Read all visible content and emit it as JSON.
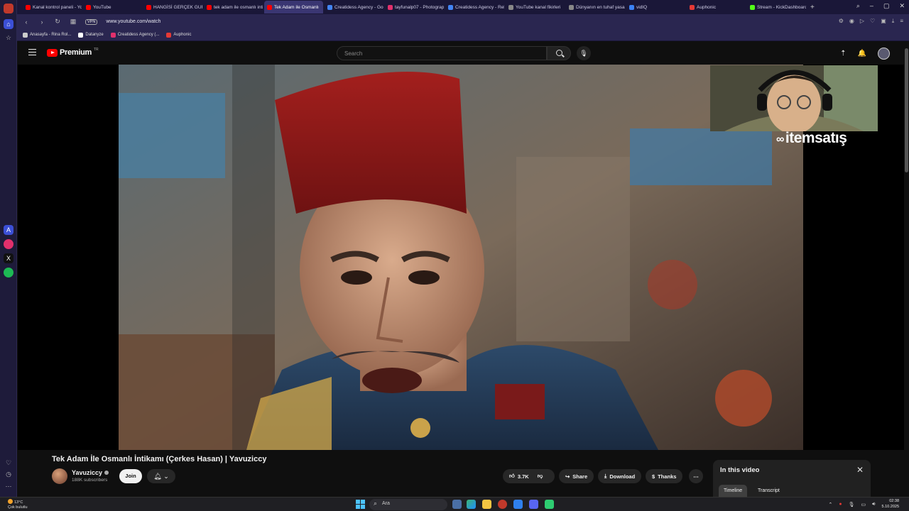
{
  "browser": {
    "tabs": [
      {
        "label": "Kanal kontrol paneli - You",
        "color": "#ff0000"
      },
      {
        "label": "YouTube",
        "color": "#ff0000"
      },
      {
        "label": "HANGİSİ GERÇEK GURBET",
        "color": "#ff0000"
      },
      {
        "label": "tek adam ile osmanlı intik",
        "color": "#ff0000"
      },
      {
        "label": "Tek Adam ile Osmanlı",
        "color": "#ff0000",
        "active": true
      },
      {
        "label": "Creatidess Agency - Goog",
        "color": "#4285f4"
      },
      {
        "label": "tayfunalp07 - Photograph",
        "color": "#e1306c"
      },
      {
        "label": "Creatidess Agency - Rekla",
        "color": "#4285f4"
      },
      {
        "label": "YouTube kanal fikirleri",
        "color": "#888888"
      },
      {
        "label": "Dünyanın en tuhaf yasala",
        "color": "#888888"
      },
      {
        "label": "vidIQ",
        "color": "#3b82f6"
      },
      {
        "label": "Auphonic",
        "color": "#e53935"
      },
      {
        "label": "Stream - KickDashboard",
        "color": "#53fc18"
      }
    ],
    "new_tab": "+",
    "url": "www.youtube.com/watch",
    "vpn_label": "VPN",
    "bookmarks": [
      {
        "label": "Anasayfa - Rina Rol...",
        "color": "#cccccc"
      },
      {
        "label": "Datanyze",
        "color": "#ffffff"
      },
      {
        "label": "Creatidess Agency (...",
        "color": "#e1306c"
      },
      {
        "label": "Auphonic",
        "color": "#e53935"
      }
    ]
  },
  "youtube": {
    "logo_text": "Premium",
    "country_code": "TR",
    "search_placeholder": "Search",
    "video": {
      "title": "Tek Adam İle Osmanlı İntikamı (Çerkes Hasan) | Yavuziccy",
      "channel": "Yavuziccy",
      "subscribers": "188K subscribers",
      "join_label": "Join",
      "likes": "3.7K",
      "share_label": "Share",
      "download_label": "Download",
      "thanks_label": "Thanks",
      "more_label": "⋯"
    },
    "side_panel": {
      "title": "In this video",
      "tabs": [
        "Timeline",
        "Transcript"
      ]
    }
  },
  "overlay": {
    "sponsor_text": "itemsatış"
  },
  "taskbar": {
    "weather_temp": "13°C",
    "weather_desc": "Çok bulutlu",
    "search_label": "Ara",
    "time": "02:38",
    "date": "5.10.2025"
  }
}
